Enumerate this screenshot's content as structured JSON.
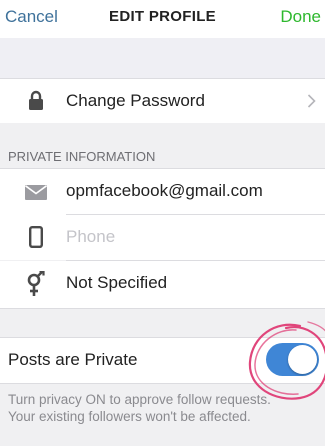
{
  "header": {
    "cancel_label": "Cancel",
    "title": "EDIT PROFILE",
    "done_label": "Done"
  },
  "account": {
    "change_password_label": "Change Password"
  },
  "private_information": {
    "section_title": "PRIVATE INFORMATION",
    "email_value": "opmfacebook@gmail.com",
    "phone_placeholder": "Phone",
    "gender_value": "Not Specified"
  },
  "privacy": {
    "posts_private_label": "Posts are Private",
    "posts_private_on": true,
    "note_line1": "Turn privacy ON to approve follow requests.",
    "note_line2": "Your existing followers won't be affected."
  },
  "colors": {
    "cancel_link": "#3f729b",
    "done_link": "#2eb82e",
    "toggle_on": "#3f86d6",
    "annotation_circle": "#e0457b"
  },
  "icons": {
    "password": "lock-icon",
    "email": "envelope-icon",
    "phone": "phone-icon",
    "gender": "gender-icon",
    "chevron": "chevron-right-icon"
  }
}
